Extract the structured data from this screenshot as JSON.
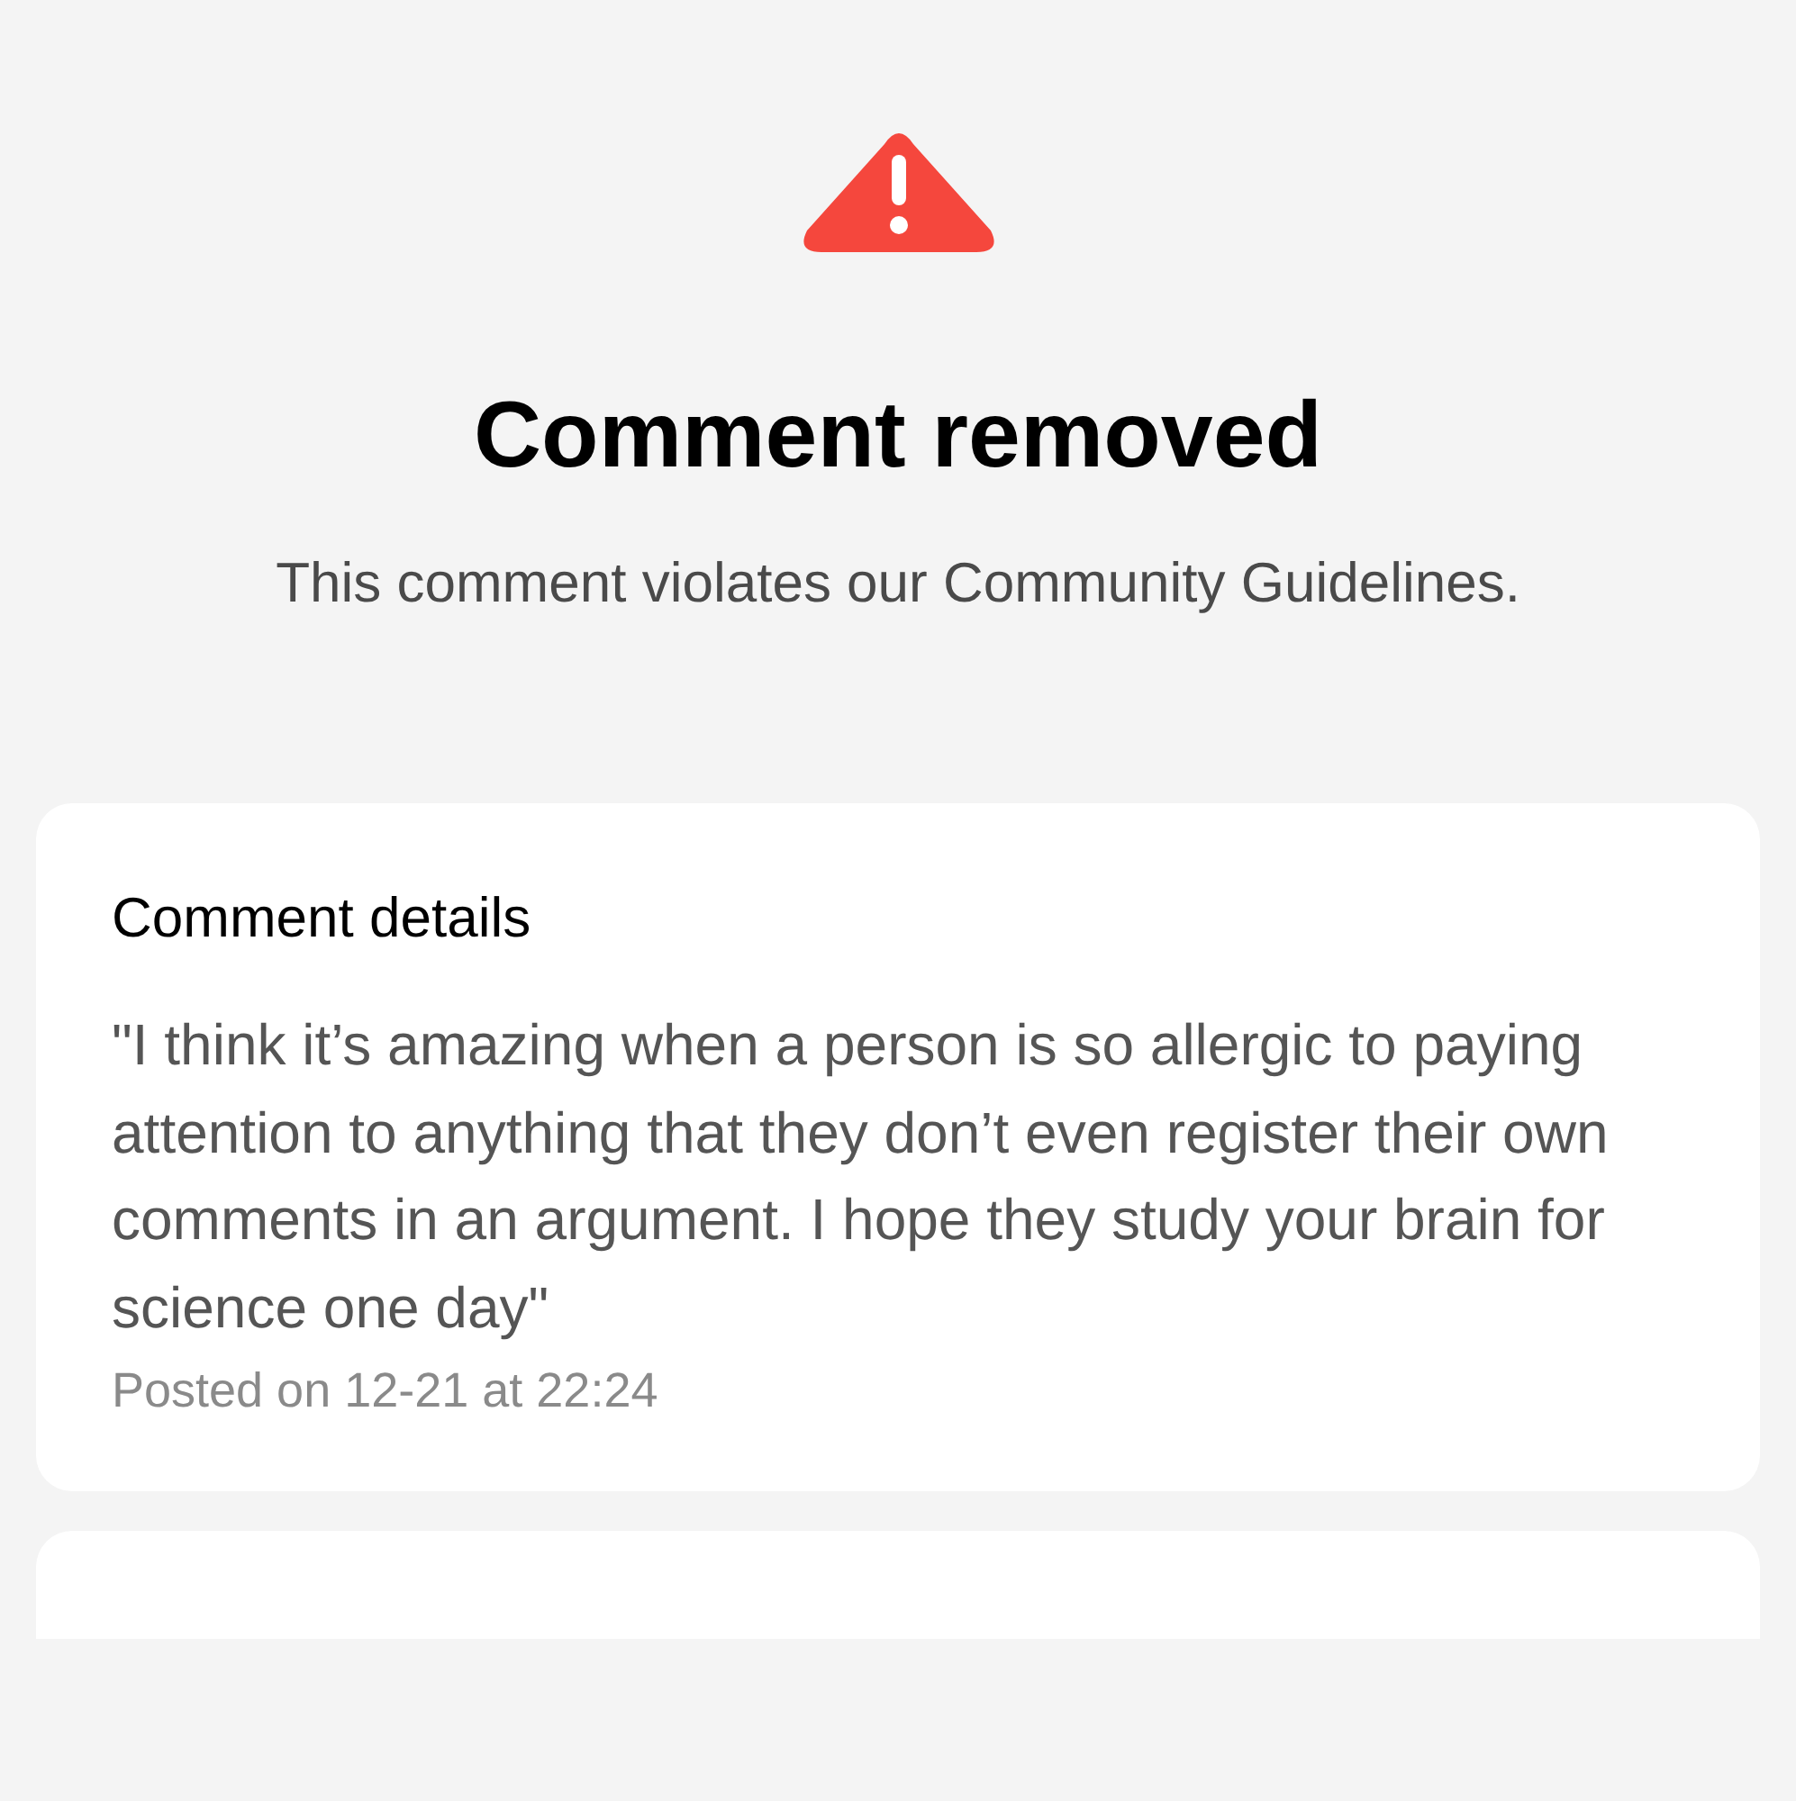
{
  "header": {
    "title": "Comment removed",
    "message": "This comment violates our Community Guidelines."
  },
  "card": {
    "title": "Comment details",
    "comment": "\"I think it’s amazing when a person is so allergic to paying attention to anything that they don’t even register their own comments in an argument. I hope they study your brain for science one day\"",
    "posted": "Posted on 12-21 at 22:24"
  }
}
